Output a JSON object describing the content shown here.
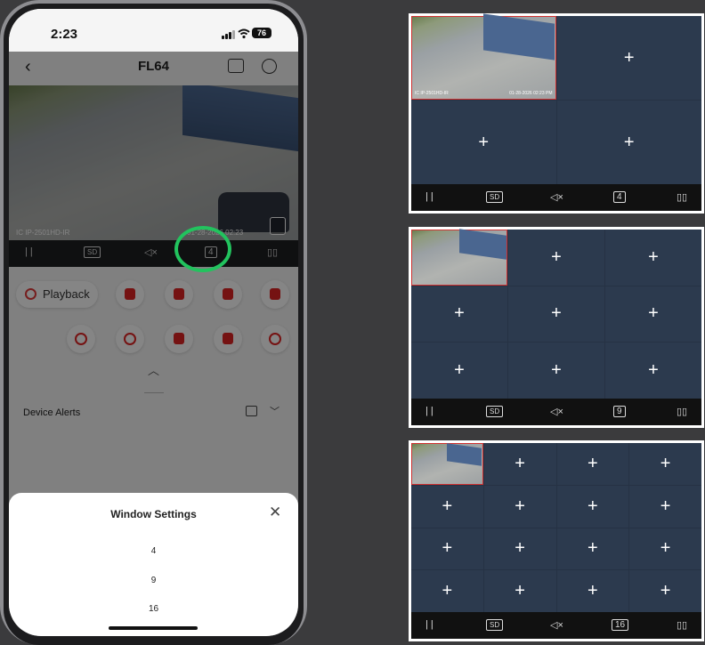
{
  "phone": {
    "status_time": "2:23",
    "battery": "76",
    "title": "FL64",
    "camera_label": "IC IP-2501HD-IR",
    "camera_time": "01-28-2026 02:23",
    "toolbar": {
      "pause": "| |",
      "quality": "SD",
      "mute": "◁×",
      "layout": "4",
      "device": "▯▯"
    },
    "playback_label": "Playback",
    "device_alerts_label": "Device Alerts",
    "sheet": {
      "title": "Window Settings",
      "close": "✕",
      "options": [
        "4",
        "9",
        "16"
      ]
    }
  },
  "panels": [
    {
      "layout": "4",
      "cols": 2,
      "rows": 2,
      "plus": "+",
      "feed_label": "IC IP-2501HD-IR",
      "feed_time": "01-28-2026 02:23 PM"
    },
    {
      "layout": "9",
      "cols": 3,
      "rows": 3,
      "plus": "+"
    },
    {
      "layout": "16",
      "cols": 4,
      "rows": 4,
      "plus": "+"
    }
  ],
  "bar_labels": {
    "pause": "| |",
    "quality": "SD",
    "mute": "◁×",
    "device": "▯▯"
  },
  "colors": {
    "accent": "#22c35e",
    "tile": "#2c3a4e",
    "alert_red": "#e02424"
  }
}
